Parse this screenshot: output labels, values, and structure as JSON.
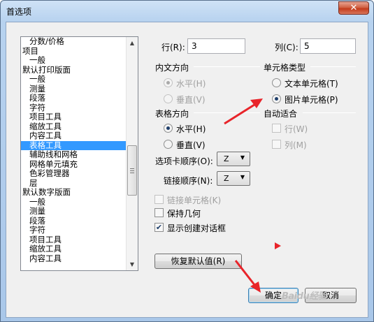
{
  "window": {
    "title": "首选项",
    "close_glyph": "✕"
  },
  "tree": {
    "items": [
      {
        "label": "分数/价格",
        "level": 1
      },
      {
        "label": "项目",
        "level": 0
      },
      {
        "label": "一般",
        "level": 1
      },
      {
        "label": "默认打印版面",
        "level": 0
      },
      {
        "label": "一般",
        "level": 1
      },
      {
        "label": "测量",
        "level": 1
      },
      {
        "label": "段落",
        "level": 1
      },
      {
        "label": "字符",
        "level": 1
      },
      {
        "label": "项目工具",
        "level": 1
      },
      {
        "label": "缩放工具",
        "level": 1
      },
      {
        "label": "内容工具",
        "level": 1
      },
      {
        "label": "表格工具",
        "level": 1,
        "selected": true
      },
      {
        "label": "辅助线和网格",
        "level": 1
      },
      {
        "label": "网格单元填充",
        "level": 1
      },
      {
        "label": "色彩管理器",
        "level": 1
      },
      {
        "label": "层",
        "level": 1
      },
      {
        "label": "默认数字版面",
        "level": 0
      },
      {
        "label": "一般",
        "level": 1
      },
      {
        "label": "测量",
        "level": 1
      },
      {
        "label": "段落",
        "level": 1
      },
      {
        "label": "字符",
        "level": 1
      },
      {
        "label": "项目工具",
        "level": 1
      },
      {
        "label": "缩放工具",
        "level": 1
      },
      {
        "label": "内容工具",
        "level": 1
      }
    ]
  },
  "rows": {
    "label": "行(R):",
    "value": "3"
  },
  "cols": {
    "label": "列(C):",
    "value": "5"
  },
  "text_direction": {
    "title": "内文方向",
    "horizontal": "水平(H)",
    "vertical": "垂直(V)"
  },
  "cell_type": {
    "title": "单元格类型",
    "text_cell": "文本单元格(T)",
    "image_cell": "图片单元格(P)"
  },
  "table_direction": {
    "title": "表格方向",
    "horizontal": "水平(H)",
    "vertical": "垂直(V)"
  },
  "auto_fit": {
    "title": "自动适合",
    "row": "行(W)",
    "col": "列(M)"
  },
  "tab_order": {
    "label": "选项卡顺序(O):",
    "value": "Z"
  },
  "link_order": {
    "label": "链接顺序(N):",
    "value": "Z"
  },
  "options": {
    "link_cells": "链接单元格(K)",
    "keep_geometry": "保持几何",
    "show_dialog": "显示创建对话框"
  },
  "buttons": {
    "restore": "恢复默认值(R)",
    "ok": "确定",
    "cancel": "取消"
  },
  "watermark": "Baidu经验",
  "colors": {
    "selection": "#3399ff",
    "annotation_arrow": "#e8242a"
  }
}
